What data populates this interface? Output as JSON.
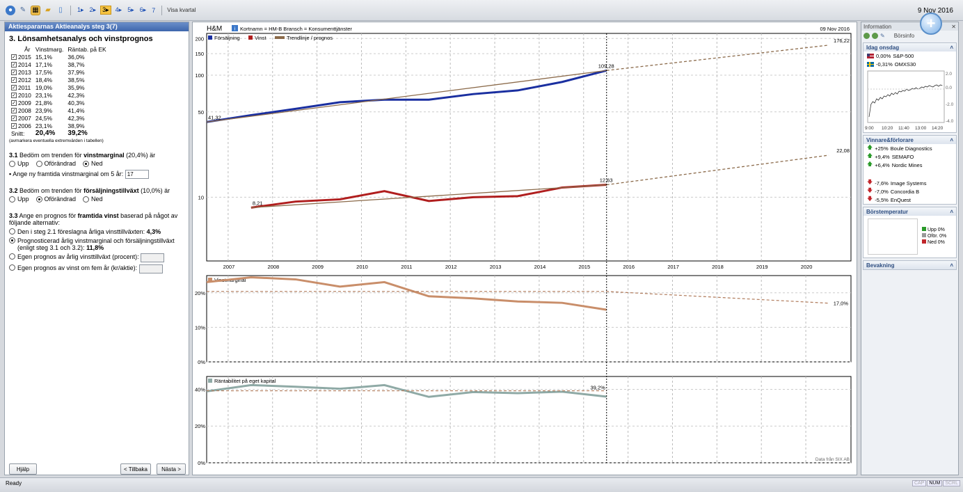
{
  "toolbar": {
    "steps": [
      "1",
      "2",
      "3",
      "4",
      "5",
      "6",
      "7"
    ],
    "active_step": "3",
    "visa_kvartal": "Visa kvartal",
    "date": "9 Nov 2016"
  },
  "left": {
    "title": "Aktiespararnas Aktieanalys steg 3(7)",
    "heading": "3. Lönsamhetsanalys och vinstprognos",
    "col_year": "År",
    "col_margin": "Vinstmarg.",
    "col_roe": "Räntab. på EK",
    "rows": [
      {
        "year": "2015",
        "margin": "15,1%",
        "roe": "36,0%"
      },
      {
        "year": "2014",
        "margin": "17,1%",
        "roe": "38,7%"
      },
      {
        "year": "2013",
        "margin": "17,5%",
        "roe": "37,9%"
      },
      {
        "year": "2012",
        "margin": "18,4%",
        "roe": "38,5%"
      },
      {
        "year": "2011",
        "margin": "19,0%",
        "roe": "35,9%"
      },
      {
        "year": "2010",
        "margin": "23,1%",
        "roe": "42,3%"
      },
      {
        "year": "2009",
        "margin": "21,8%",
        "roe": "40,3%"
      },
      {
        "year": "2008",
        "margin": "23,9%",
        "roe": "41,4%"
      },
      {
        "year": "2007",
        "margin": "24,5%",
        "roe": "42,3%"
      },
      {
        "year": "2006",
        "margin": "23,1%",
        "roe": "38,9%"
      }
    ],
    "avg_label": "Snitt:",
    "avg_margin": "20,4%",
    "avg_roe": "39,2%",
    "note": "(avmarkera eventuella extremvärden i tabellen)",
    "q31_prefix": "3.1",
    "q31_text": "Bedöm om trenden för",
    "q31_bold": "vinstmarginal",
    "q31_suffix": "(20,4%) är",
    "opt_up": "Upp",
    "opt_unchanged": "Oförändrad",
    "opt_down": "Ned",
    "future_margin_label": "Ange ny framtida vinstmarginal om 5 år:",
    "future_margin_value": "17",
    "q32_prefix": "3.2",
    "q32_text": "Bedöm om trenden för",
    "q32_bold": "försäljningstillväxt",
    "q32_suffix": "(10,0%) är",
    "q33_prefix": "3.3",
    "q33_text": "Ange en prognos för",
    "q33_bold": "framtida vinst",
    "q33_suffix": "baserad på något av följande alternativ:",
    "alt1": "Den i steg 2.1 föreslagna årliga vinsttillväxten:",
    "alt1_value": "4,3%",
    "alt2_line1": "Prognosticerad årlig vinstmarginal och försäljningstillväxt",
    "alt2_line2": "(enligt steg 3.1 och 3.2):",
    "alt2_value": "11,8%",
    "alt3": "Egen prognos av årlig vinsttillväxt (procent):",
    "alt4": "Egen prognos av vinst om fem år (kr/aktie):",
    "help_button": "Hjälp",
    "back_button": "< Tillbaka",
    "next_button": "Nästa >"
  },
  "main_chart": {
    "company": "H&M",
    "info": "Kortnamn = HM-B   Bransch = Konsumenttjänster",
    "date": "09 Nov 2016",
    "legend_sales": "Försäljning",
    "legend_profit": "Vinst",
    "legend_trend": "Trendlinje / prognos",
    "sales_start_label": "41,32",
    "sales_end_label": "109,28",
    "sales_forecast_label": "176,22",
    "profit_start_label": "8,21",
    "profit_end_label": "12,63",
    "profit_forecast_label": "22,08",
    "source": "Data från SIX AB"
  },
  "chart_data": [
    {
      "type": "line",
      "y_scale": "log",
      "ylim": [
        3,
        220
      ],
      "y_ticks": [
        "200",
        "150",
        "100",
        "50",
        "10"
      ],
      "x_ticks": [
        "2007",
        "2008",
        "2009",
        "2010",
        "2011",
        "2012",
        "2013",
        "2014",
        "2015",
        "2016",
        "2017",
        "2018",
        "2019",
        "2020"
      ],
      "series": [
        {
          "name": "Försäljning",
          "color": "#1a2fa0",
          "x": [
            2006.5,
            2007.5,
            2008.5,
            2009.5,
            2010.5,
            2011.5,
            2012.5,
            2013.5,
            2014.5,
            2015.5
          ],
          "values": [
            41.32,
            47,
            53,
            60,
            63,
            63,
            70,
            75,
            88,
            109.28
          ]
        },
        {
          "name": "Vinst",
          "color": "#b01e1e",
          "x": [
            2007.5,
            2008.5,
            2009.5,
            2010.5,
            2011.5,
            2012.5,
            2013.5,
            2014.5,
            2015.5
          ],
          "values": [
            8.21,
            9.2,
            9.6,
            11.2,
            9.3,
            10.0,
            10.2,
            12.0,
            12.63
          ]
        },
        {
          "name": "Trendlinje / prognos",
          "color": "#8b6a4a",
          "x": [
            2006.5,
            2015.5
          ],
          "values": [
            41.32,
            109.28
          ]
        },
        {
          "name": "Trendlinje / prognos",
          "color": "#8b6a4a",
          "x": [
            2007.5,
            2015.5
          ],
          "values": [
            8.21,
            12.63
          ]
        },
        {
          "name": "Trendlinje / prognos",
          "color": "#8b6a4a",
          "dashed": true,
          "x": [
            2015.5,
            2020.5
          ],
          "values": [
            109.28,
            176.22
          ]
        },
        {
          "name": "Trendlinje / prognos",
          "color": "#8b6a4a",
          "dashed": true,
          "x": [
            2015.5,
            2020.5
          ],
          "values": [
            12.63,
            22.08
          ]
        }
      ]
    },
    {
      "type": "line",
      "title": "Vinstmarginal",
      "ylim": [
        0,
        25
      ],
      "y_ticks": [
        "20%",
        "10%",
        "0%"
      ],
      "series": [
        {
          "name": "Vinstmarginal",
          "color": "#c98e6a",
          "x": [
            2006.5,
            2007.5,
            2008.5,
            2009.5,
            2010.5,
            2011.5,
            2012.5,
            2013.5,
            2014.5,
            2015.5
          ],
          "values": [
            23.1,
            24.5,
            23.9,
            21.8,
            23.1,
            19.0,
            18.4,
            17.5,
            17.1,
            15.1
          ]
        },
        {
          "name": "avg",
          "color": "#b07a5a",
          "dashed": true,
          "x": [
            2006.5,
            2015.5,
            2020.5
          ],
          "values": [
            20.4,
            20.4,
            17.0
          ]
        }
      ],
      "end_label": "17,0%"
    },
    {
      "type": "line",
      "title": "Räntabilitet på eget kapital",
      "ylim": [
        0,
        47
      ],
      "y_ticks": [
        "40%",
        "20%",
        "0%"
      ],
      "series": [
        {
          "name": "Räntabilitet på eget kapital",
          "color": "#8faaa6",
          "x": [
            2006.5,
            2007.5,
            2008.5,
            2009.5,
            2010.5,
            2011.5,
            2012.5,
            2013.5,
            2014.5,
            2015.5
          ],
          "values": [
            38.9,
            42.3,
            41.4,
            40.3,
            42.3,
            35.9,
            38.5,
            37.9,
            38.7,
            36.0
          ]
        },
        {
          "name": "avg",
          "color": "#b07a5a",
          "dashed": true,
          "x": [
            2006.5,
            2015.5
          ],
          "values": [
            39.2,
            39.2
          ]
        }
      ],
      "end_label": "39,2%"
    }
  ],
  "right": {
    "title": "Information",
    "borsinfo": "Börsinfo",
    "today_header": "Idag onsdag",
    "idx1_value": "0,00%",
    "idx1_name": "S&P-500",
    "idx2_value": "-0,31%",
    "idx2_name": "OMXS30",
    "mini_ticks": [
      "2.0",
      "0.0",
      "-2.0",
      "-4.0"
    ],
    "mini_times": [
      "9:00",
      "10:20",
      "11:40",
      "13:00",
      "14:20"
    ],
    "movers_header": "Vinnare&förlorare",
    "winners": [
      {
        "pct": "+25%",
        "name": "Boule Diagnostics"
      },
      {
        "pct": "+9,4%",
        "name": "SEMAFO"
      },
      {
        "pct": "+6,4%",
        "name": "Nordic Mines"
      }
    ],
    "losers": [
      {
        "pct": "-7,6%",
        "name": "Image Systems"
      },
      {
        "pct": "-7,0%",
        "name": "Concordia B"
      },
      {
        "pct": "-5,5%",
        "name": "EnQuest"
      }
    ],
    "temp_header": "Börstemperatur",
    "temp_up": "Upp 0%",
    "temp_unch": "Oför. 0%",
    "temp_down": "Ned 0%",
    "watch_header": "Bevakning"
  },
  "status": {
    "text": "Ready",
    "keys": [
      "CAP",
      "NUM",
      "SCRL"
    ]
  }
}
